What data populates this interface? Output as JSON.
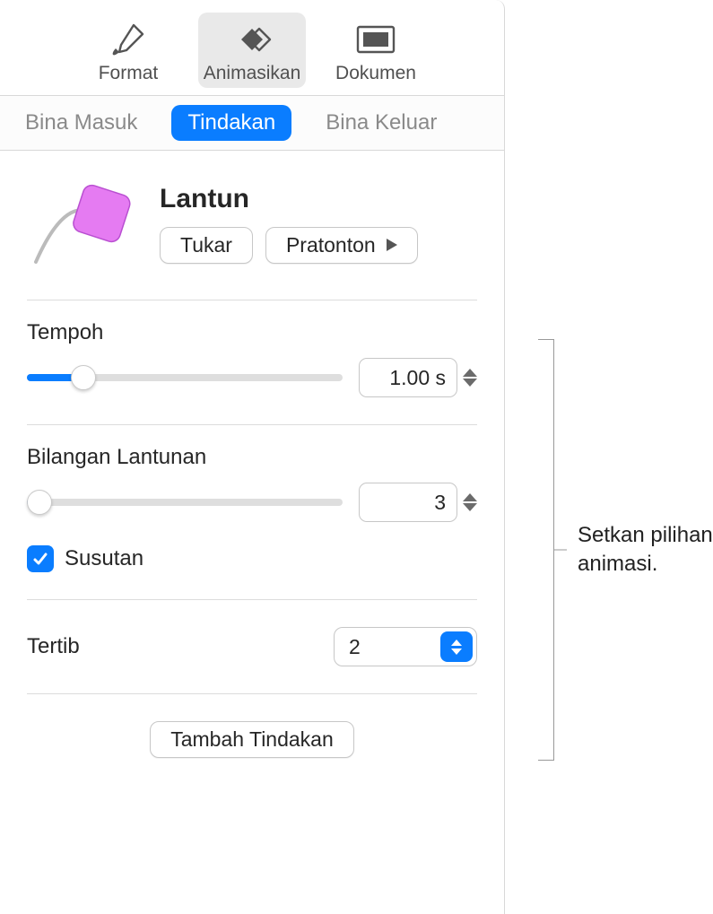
{
  "toolbar": {
    "format": "Format",
    "animate": "Animasikan",
    "document": "Dokumen"
  },
  "tabs": {
    "buildIn": "Bina Masuk",
    "action": "Tindakan",
    "buildOut": "Bina Keluar"
  },
  "effect": {
    "title": "Lantun",
    "change": "Tukar",
    "preview": "Pratonton"
  },
  "duration": {
    "label": "Tempoh",
    "value": "1.00 s",
    "slider_percent": 18
  },
  "bounces": {
    "label": "Bilangan Lantunan",
    "value": "3",
    "slider_percent": 4,
    "decay_label": "Susutan",
    "decay_checked": true
  },
  "order": {
    "label": "Tertib",
    "value": "2"
  },
  "add_action": "Tambah Tindakan",
  "callout": "Setkan pilihan\nanimasi."
}
